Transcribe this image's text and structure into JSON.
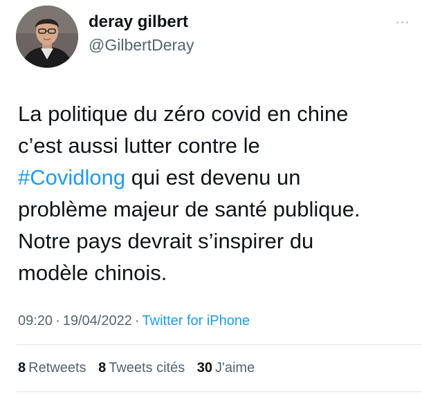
{
  "author": {
    "name": "deray gilbert",
    "handle": "@GilbertDeray"
  },
  "tweet": {
    "line1": "La politique du zéro covid en chine",
    "line2": "c’est aussi lutter contre le",
    "hashtag": "#Covidlong",
    "line3_rest": " qui est devenu un",
    "line4": "problème majeur de santé publique.",
    "line5": "Notre pays devrait s’inspirer du",
    "line6": "modèle chinois."
  },
  "meta": {
    "time": "09:20",
    "separator": "·",
    "date": "19/04/2022",
    "source": "Twitter for iPhone"
  },
  "stats": {
    "retweets_count": "8",
    "retweets_label": "Retweets",
    "quotes_count": "8",
    "quotes_label": "Tweets cités",
    "likes_count": "30",
    "likes_label": "J'aime"
  },
  "colors": {
    "text": "#0f1419",
    "secondary": "#536471",
    "link": "#1d9bf0",
    "divider": "#e1e6ea"
  },
  "icons": {
    "more": "more-horizontal-icon",
    "avatar": "profile-photo"
  }
}
